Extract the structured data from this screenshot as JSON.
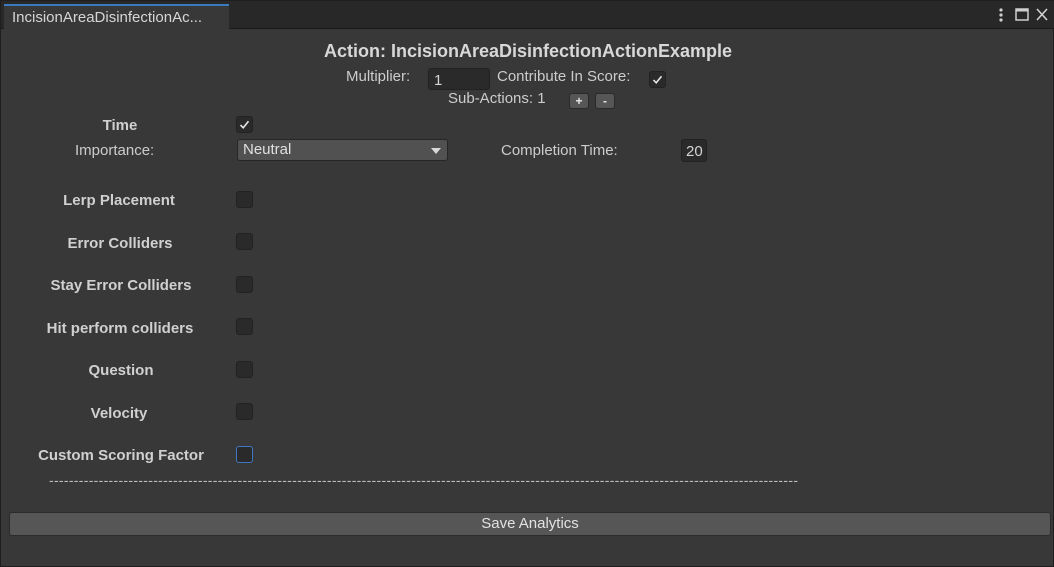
{
  "window": {
    "tab_title": "IncisionAreaDisinfectionAc...",
    "controls": {
      "menu_icon": "kebab-menu-icon",
      "maximize_icon": "maximize-icon",
      "close_icon": "close-icon"
    }
  },
  "header": {
    "title": "Action: IncisionAreaDisinfectionActionExample",
    "multiplier_label": "Multiplier:",
    "multiplier_value": "1",
    "contribute_label": "Contribute In Score:",
    "contribute_checked": true,
    "subactions_label": "Sub-Actions: 1",
    "add_label": "+",
    "remove_label": "-"
  },
  "time": {
    "label": "Time",
    "checked": true,
    "importance_label": "Importance:",
    "importance_value": "Neutral",
    "completion_label": "Completion Time:",
    "completion_value": "20"
  },
  "options": [
    {
      "label": "Lerp Placement",
      "checked": false
    },
    {
      "label": "Error Colliders",
      "checked": false
    },
    {
      "label": "Stay Error Colliders",
      "checked": false
    },
    {
      "label": "Hit perform colliders",
      "checked": false
    },
    {
      "label": "Question",
      "checked": false
    },
    {
      "label": "Velocity",
      "checked": false
    },
    {
      "label": "Custom Scoring Factor",
      "checked": false,
      "focused": true
    }
  ],
  "divider_text": "-------------------------------------------------------------------------------------------------------------------------------------------------------",
  "footer": {
    "save_label": "Save Analytics"
  },
  "colors": {
    "background": "#383838",
    "tab_accent": "#3a79bb",
    "button": "#565656",
    "field": "#2a2a2a"
  }
}
